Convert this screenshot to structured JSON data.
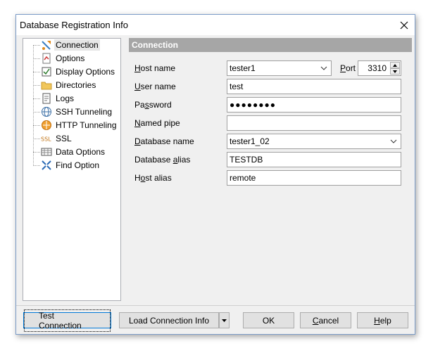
{
  "window": {
    "title": "Database Registration Info"
  },
  "tree": {
    "items": [
      {
        "label": "Connection",
        "icon": "connection-icon",
        "selected": true
      },
      {
        "label": "Options",
        "icon": "options-icon"
      },
      {
        "label": "Display Options",
        "icon": "display-options-icon"
      },
      {
        "label": "Directories",
        "icon": "folder-icon"
      },
      {
        "label": "Logs",
        "icon": "logs-icon"
      },
      {
        "label": "SSH Tunneling",
        "icon": "globe-icon"
      },
      {
        "label": "HTTP Tunneling",
        "icon": "http-icon"
      },
      {
        "label": "SSL",
        "icon": "ssl-icon"
      },
      {
        "label": "Data Options",
        "icon": "data-options-icon"
      },
      {
        "label": "Find Option",
        "icon": "find-icon"
      }
    ]
  },
  "panel": {
    "title": "Connection"
  },
  "fields": {
    "host_name": {
      "label": "Host name",
      "value": "tester1"
    },
    "port": {
      "label": "Port",
      "value": "3310"
    },
    "user_name": {
      "label": "User name",
      "value": "test"
    },
    "password": {
      "label": "Password",
      "value": "●●●●●●●●"
    },
    "named_pipe": {
      "label": "Named pipe",
      "value": ""
    },
    "database_name": {
      "label": "Database name",
      "value": "tester1_02"
    },
    "database_alias": {
      "label": "Database alias",
      "value": "TESTDB"
    },
    "host_alias": {
      "label": "Host alias",
      "value": "remote"
    }
  },
  "buttons": {
    "test_connection": "Test Connection",
    "load_connection_info": "Load Connection Info",
    "ok": "OK",
    "cancel": "Cancel",
    "help": "Help"
  },
  "colors": {
    "panel_header": "#a6a6a6",
    "selection": "#e6e6e6",
    "default_border": "#0078d7"
  }
}
